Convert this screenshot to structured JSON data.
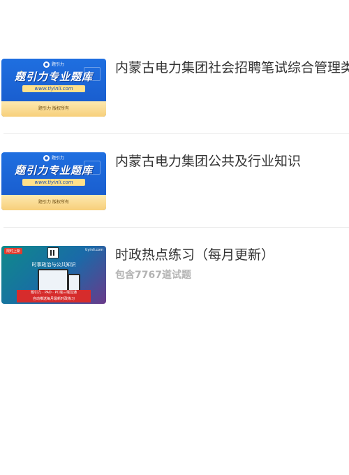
{
  "courses": [
    {
      "title": "内蒙古电力集团社会招聘笔试综合管理类",
      "subtitle": "",
      "thumbnail": {
        "style": "promo",
        "brand": "题引力",
        "headline": "题引力专业题库",
        "url": "www.tiyinli.com",
        "footer": "题引力 版权所有"
      }
    },
    {
      "title": "内蒙古电力集团公共及行业知识",
      "subtitle": "",
      "thumbnail": {
        "style": "promo",
        "brand": "题引力",
        "headline": "题引力专业题库",
        "url": "www.tiyinli.com",
        "footer": "题引力 版权所有"
      }
    },
    {
      "title": "时政热点练习（每月更新）",
      "subtitle": "包含7767道试题",
      "thumbnail": {
        "style": "affairs",
        "tag": "限时上新",
        "site": "tiyinli.com",
        "heading": "时事政治与公共知识",
        "footer_line1": "题引力 · PAD · PC端三端互通",
        "footer_line2": "自动推送每月最新时政练习"
      }
    }
  ],
  "colors": {
    "title": "#333333",
    "subtitle": "#b3b3b3",
    "divider": "#ececec",
    "promo_blue": "#1a5fd0",
    "promo_gold": "#f7cf7a",
    "affairs_red": "#d62c2c"
  }
}
